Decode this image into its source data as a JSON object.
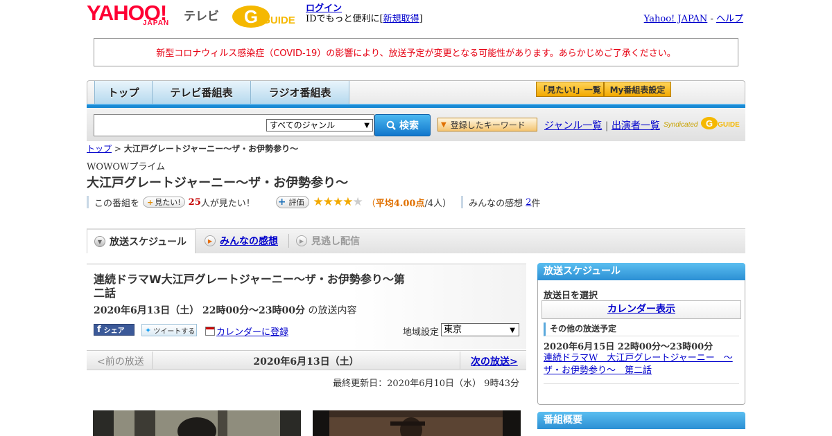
{
  "header": {
    "logo_yahoo": "YAHOO!",
    "logo_japan": "JAPAN",
    "logo_tv": "テレビ",
    "logo_gguide": "GUIDE",
    "login_link": "ログイン",
    "login_sub_prefix": "IDでもっと便利に[",
    "signup_link": "新規取得",
    "login_sub_suffix": "]",
    "yahoo_japan_link": "Yahoo! JAPAN",
    "help_sep": "-",
    "help_link": "ヘルプ"
  },
  "notice": "新型コロナウィルス感染症（COVID-19）の影響により、放送予定が変更となる可能性があります。あらかじめご了承ください。",
  "nav": {
    "tabs": [
      "トップ",
      "テレビ番組表",
      "ラジオ番組表"
    ],
    "mitai_list": "「見たい!」一覧",
    "my_settings": "My番組表設定"
  },
  "search": {
    "genre_selected": "すべてのジャンル",
    "button": "検索",
    "keyword_button": "登録したキーワード",
    "genre_link": "ジャンル一覧",
    "sep": "|",
    "performer_link": "出演者一覧",
    "syndicated": "Syndicated"
  },
  "breadcrumb": {
    "top": "トップ",
    "sep": ">",
    "current": "大江戸グレートジャーニー～ザ・お伊勢参り～"
  },
  "program": {
    "channel": "WOWOWプライム",
    "title": "大江戸グレートジャーニー～ザ・お伊勢参り～",
    "mitai_prefix": "この番組を",
    "mitai_pill": "見たい!",
    "mitai_count": "25",
    "mitai_suffix": "人が見たい！",
    "hyoka_pill": "評価",
    "rating": 4,
    "rating_max": 5,
    "avg_open": "（",
    "avg_text": "平均4.00点",
    "avg_people": "/4人）",
    "impressions_prefix": "みんなの感想",
    "impressions_count": "2",
    "impressions_suffix": "件"
  },
  "content_tabs": {
    "schedule": "放送スケジュール",
    "impressions": "みんなの感想",
    "vod": "見逃し配信"
  },
  "episode": {
    "title": "連続ドラマW大江戸グレートジャーニー～ザ・お伊勢参り～第二話",
    "datetime": "2020年6月13日（土） 22時00分～23時00分",
    "datetime_suffix": "の放送内容",
    "facebook": "シェア",
    "tweet": "ツイートする",
    "calendar": "カレンダーに登録",
    "region_label": "地域設定",
    "region_value": "東京"
  },
  "datebar": {
    "prev": "<前の放送",
    "date": "2020年6月13日（土）",
    "next": "次の放送>"
  },
  "updated": "最終更新日：2020年6月10日（水） 9時43分",
  "sidebar": {
    "schedule_head": "放送スケジュール",
    "select_label": "放送日を選択",
    "calendar_button": "カレンダー表示",
    "other_head": "その他の放送予定",
    "other_date": "2020年6月15日 22時00分～23時00分",
    "other_link": "連続ドラマW　大江戸グレートジャーニー　～ザ・お伊勢参り～　第二話",
    "summary_head": "番組概要"
  }
}
